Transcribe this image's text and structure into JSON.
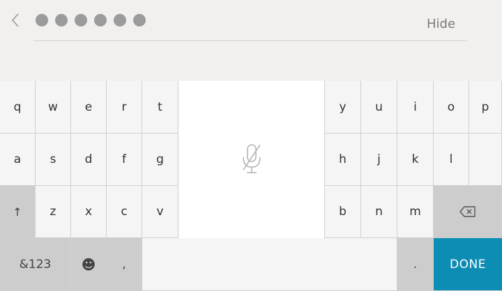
{
  "header": {
    "back_icon": "chevron-left-icon",
    "pin_dots_count": 6,
    "hide_label": "Hide"
  },
  "keyboard": {
    "row1": [
      "q",
      "w",
      "e",
      "r",
      "t",
      "y",
      "u",
      "i",
      "o",
      "p"
    ],
    "row2": [
      "a",
      "s",
      "d",
      "f",
      "g",
      "h",
      "j",
      "k",
      "l"
    ],
    "row3": [
      "z",
      "x",
      "c",
      "v",
      "b",
      "n",
      "m"
    ],
    "shift_glyph": "↑",
    "numbers_label": "&123",
    "emoji_glyph": "☻",
    "comma": ",",
    "period": ".",
    "done_label": "DONE",
    "mic_icon": "microphone-disabled-icon",
    "backspace_icon": "backspace-icon"
  },
  "colors": {
    "accent": "#0d8db3",
    "background": "#f1f0ee",
    "dot": "#9b9b9b"
  }
}
